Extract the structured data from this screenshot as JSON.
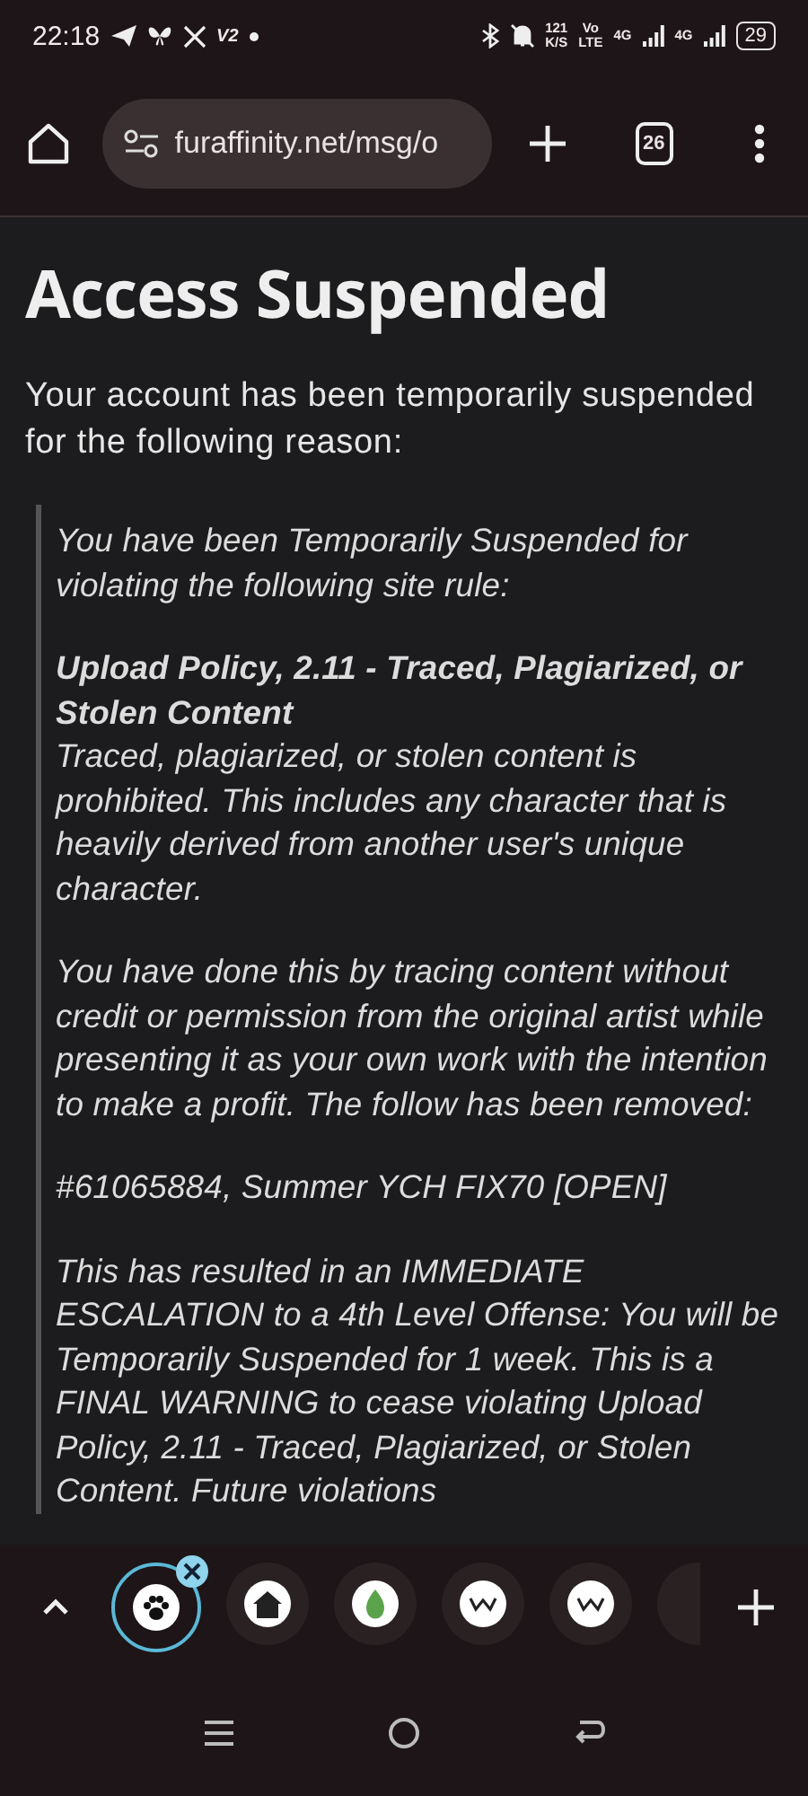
{
  "status_bar": {
    "time": "22:18",
    "app_badge": "V2",
    "speed": "121",
    "speed_unit": "K/S",
    "volte_top": "Vo",
    "volte_bottom": "LTE",
    "sim1": "4G",
    "sim2": "4G",
    "battery": "29"
  },
  "toolbar": {
    "url": "furaffinity.net/msg/o",
    "tab_count": "26"
  },
  "page": {
    "title": "Access Suspended",
    "intro": "Your account has been temporarily suspended for the following reason:",
    "quote": [
      {
        "kind": "plain",
        "text": "You have been Temporarily Suspended for violating the following site rule:"
      },
      {
        "kind": "rule",
        "title": "Upload Policy, 2.11 - Traced, Plagiarized, or Stolen Content",
        "text": "Traced, plagiarized, or stolen content is prohibited. This includes any character that is heavily derived from another user's unique character."
      },
      {
        "kind": "plain",
        "text": "You have done this by tracing content without credit or permission from the original artist while presenting it as your own work with the intention to make a profit. The follow has been removed:"
      },
      {
        "kind": "plain",
        "text": "#61065884, Summer YCH FIX70 [OPEN]"
      },
      {
        "kind": "plain",
        "text": "This has resulted in an IMMEDIATE ESCALATION to a 4th Level Offense: You will be Temporarily Suspended for 1 week. This is a FINAL WARNING to cease violating Upload Policy, 2.11 - Traced, Plagiarized, or Stolen Content. Future violations"
      }
    ]
  },
  "tab_group": [
    {
      "kind": "paw",
      "selected": true
    },
    {
      "kind": "house",
      "selected": false
    },
    {
      "kind": "leaf",
      "selected": false
    },
    {
      "kind": "crown",
      "selected": false
    },
    {
      "kind": "crown",
      "selected": false
    },
    {
      "kind": "partial",
      "selected": false
    }
  ]
}
